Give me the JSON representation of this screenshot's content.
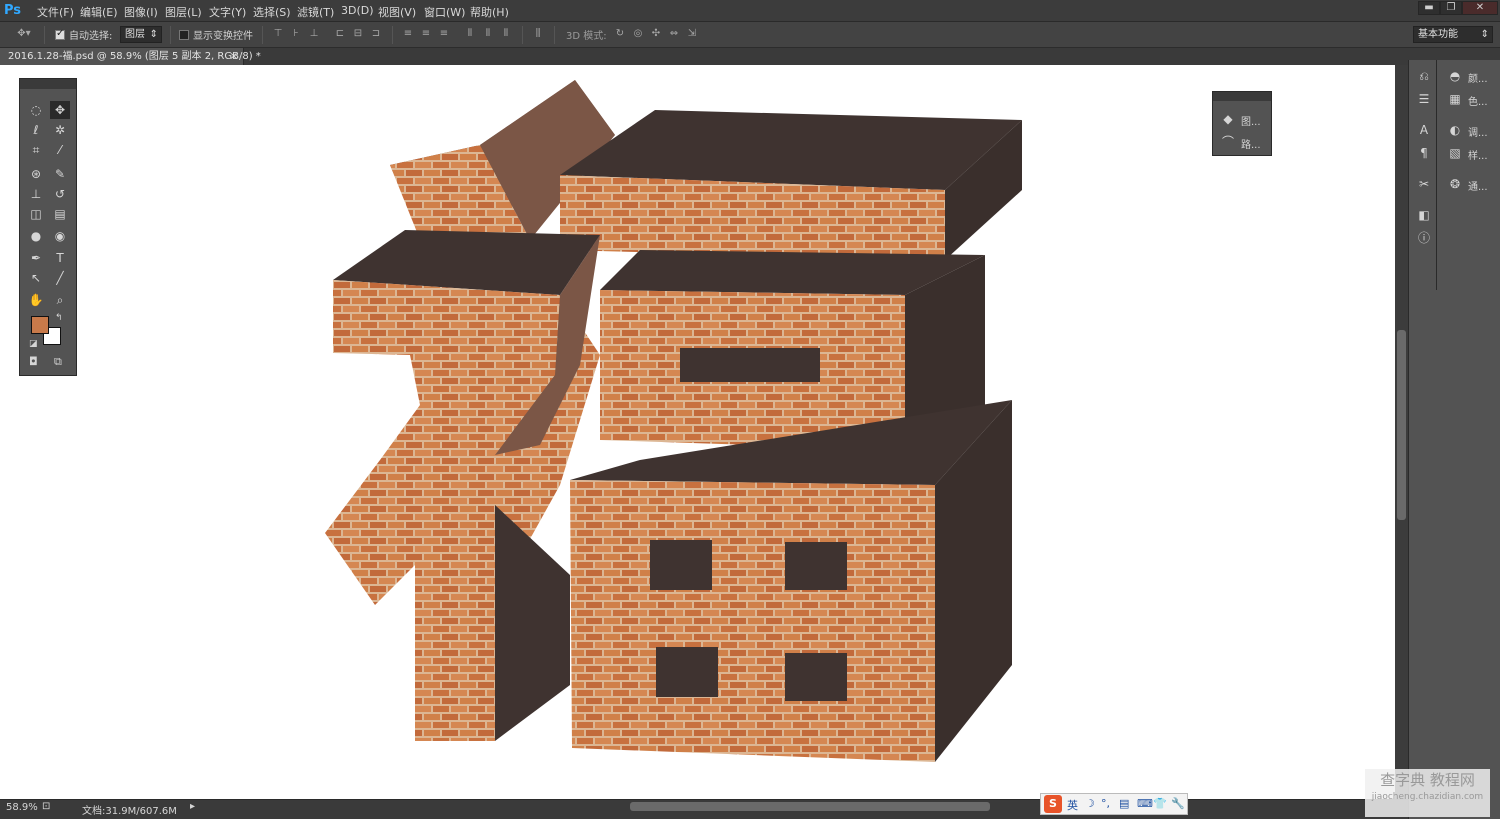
{
  "app": {
    "logo": "Ps"
  },
  "menu": [
    {
      "label": "文件(F)"
    },
    {
      "label": "编辑(E)"
    },
    {
      "label": "图像(I)"
    },
    {
      "label": "图层(L)"
    },
    {
      "label": "文字(Y)"
    },
    {
      "label": "选择(S)"
    },
    {
      "label": "滤镜(T)"
    },
    {
      "label": "3D(D)"
    },
    {
      "label": "视图(V)"
    },
    {
      "label": "窗口(W)"
    },
    {
      "label": "帮助(H)"
    }
  ],
  "window_controls": {
    "minimize": "▬",
    "restore": "❐",
    "close": "✕"
  },
  "options": {
    "auto_select_label": "自动选择:",
    "auto_select_checked": true,
    "auto_select_value": "图层",
    "show_transform_label": "显示变换控件",
    "show_transform_checked": false,
    "mode_3d_label": "3D 模式:",
    "workspace": "基本功能"
  },
  "document": {
    "tab_title": "2016.1.28-福.psd @ 58.9% (图层 5 副本 2, RGB/8) *",
    "tab_close": "×"
  },
  "status": {
    "zoom": "58.9%",
    "doc_size": "文档:31.9M/607.6M"
  },
  "tools": [
    {
      "name": "marquee",
      "glyph": "◌"
    },
    {
      "name": "move",
      "glyph": "✥"
    },
    {
      "name": "lasso",
      "glyph": "ℓ"
    },
    {
      "name": "magic-wand",
      "glyph": "✲"
    },
    {
      "name": "crop",
      "glyph": "⌗"
    },
    {
      "name": "eyedropper",
      "glyph": "⁄"
    },
    {
      "name": "healing",
      "glyph": "⊛"
    },
    {
      "name": "brush",
      "glyph": "✎"
    },
    {
      "name": "stamp",
      "glyph": "⊥"
    },
    {
      "name": "history-brush",
      "glyph": "↺"
    },
    {
      "name": "eraser",
      "glyph": "◫"
    },
    {
      "name": "gradient",
      "glyph": "▤"
    },
    {
      "name": "blur",
      "glyph": "●"
    },
    {
      "name": "dodge",
      "glyph": "◉"
    },
    {
      "name": "pen",
      "glyph": "✒"
    },
    {
      "name": "text",
      "glyph": "T"
    },
    {
      "name": "path-select",
      "glyph": "↖"
    },
    {
      "name": "line",
      "glyph": "╱"
    },
    {
      "name": "hand",
      "glyph": "✋"
    },
    {
      "name": "zoom",
      "glyph": "⌕"
    }
  ],
  "colors": {
    "foreground": "#c87a4a",
    "background": "#ffffff",
    "brick_front": "#c8794a",
    "brick_mortar": "#d9b48f",
    "dark_side": "#3f3330",
    "lit_side": "#7a5545"
  },
  "dock": {
    "items_left": [
      {
        "icon": "history-icon",
        "glyph": "⎌"
      },
      {
        "icon": "actions-icon",
        "glyph": "☰"
      },
      {
        "icon": "character-icon",
        "glyph": "A"
      },
      {
        "icon": "paragraph-icon",
        "glyph": "¶"
      },
      {
        "icon": "tools-icon",
        "glyph": "✂"
      },
      {
        "icon": "layer-comps-icon",
        "glyph": "◧"
      },
      {
        "icon": "info-icon",
        "glyph": "ⓘ"
      }
    ],
    "items_right": [
      {
        "icon": "adjustments-icon",
        "glyph": "◓",
        "label": "颜..."
      },
      {
        "icon": "swatches-icon",
        "glyph": "▦",
        "label": "色..."
      },
      {
        "icon": "adjust-icon",
        "glyph": "◐",
        "label": "调..."
      },
      {
        "icon": "styles-icon",
        "glyph": "▧",
        "label": "样..."
      },
      {
        "icon": "channels-icon",
        "glyph": "❂",
        "label": "通..."
      }
    ]
  },
  "float_panel": {
    "items": [
      {
        "icon": "layers-icon",
        "glyph": "◆",
        "label": "图..."
      },
      {
        "icon": "paths-icon",
        "glyph": "⌒",
        "label": "路..."
      }
    ]
  },
  "ime": {
    "logo": "S",
    "mode": "英",
    "icons": [
      "☽",
      "°,",
      "▤",
      "⌨",
      "👕",
      "🔧"
    ]
  },
  "watermark": {
    "line1": "查字典 教程网",
    "line2": "jiaocheng.chazidian.com"
  }
}
